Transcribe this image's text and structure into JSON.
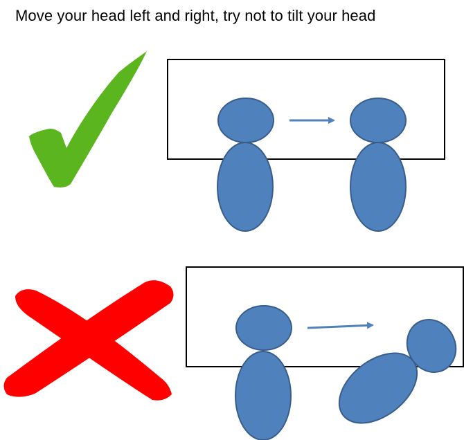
{
  "instruction": "Move your head left and right, try not to tilt your head",
  "colors": {
    "figure_fill": "#4f81bd",
    "figure_stroke": "#385d8a",
    "frame_stroke": "#000000",
    "check": "#5bb51f",
    "cross": "#ff0000"
  },
  "icons": {
    "correct": "check-mark-icon",
    "incorrect": "cross-mark-icon"
  },
  "panels": [
    {
      "name": "correct-example",
      "status": "correct",
      "meaning": "head moves sideways without tilting"
    },
    {
      "name": "incorrect-example",
      "status": "incorrect",
      "meaning": "head and body tilt while moving"
    }
  ]
}
